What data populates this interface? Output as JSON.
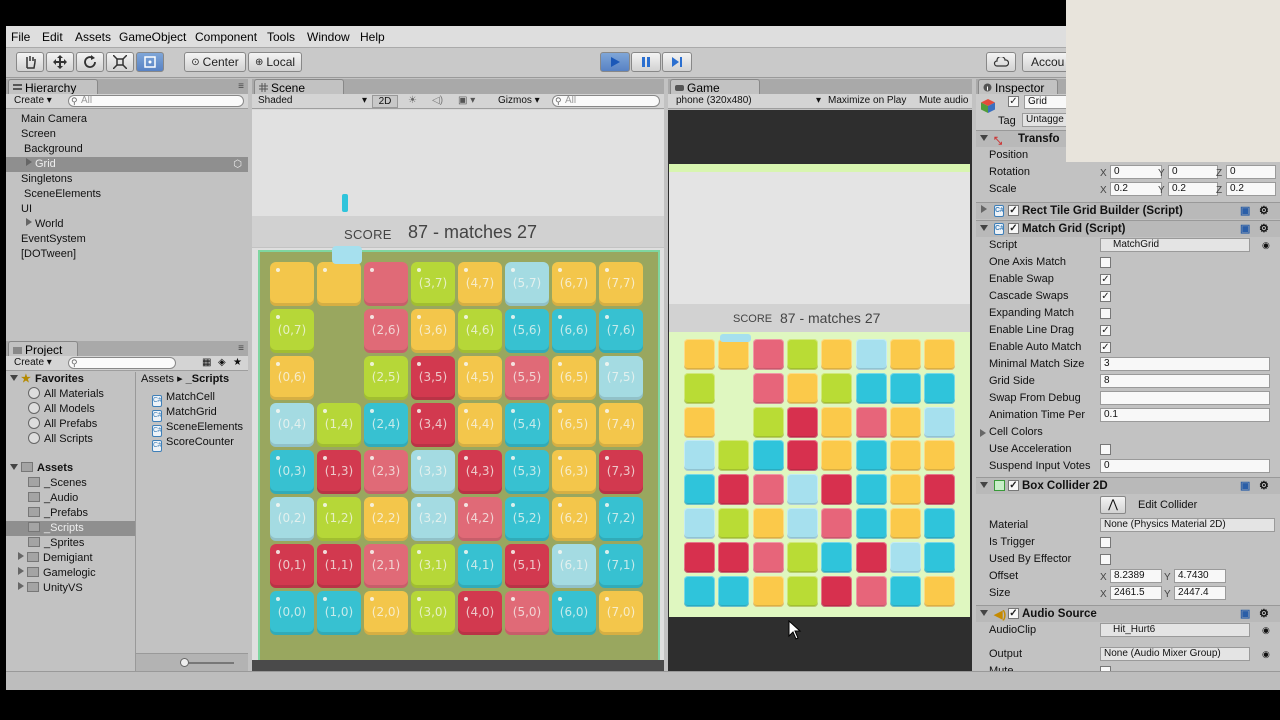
{
  "menu": [
    "File",
    "Edit",
    "Assets",
    "GameObject",
    "Component",
    "Tools",
    "Window",
    "Help"
  ],
  "toolbar": {
    "pivot": "Center",
    "space": "Local",
    "account": "Accou",
    "tool_icons": [
      "hand-icon",
      "move-icon",
      "rotate-icon",
      "scale-icon",
      "rect-icon"
    ]
  },
  "hierarchy": {
    "tab": "Hierarchy",
    "create": "Create",
    "search_placeholder": "All",
    "items": [
      {
        "label": "Main Camera",
        "indent": 0
      },
      {
        "label": "Screen",
        "indent": 0
      },
      {
        "label": "Background",
        "indent": 1
      },
      {
        "label": "Grid",
        "indent": 1,
        "selected": true
      },
      {
        "label": "Singletons",
        "indent": 0
      },
      {
        "label": "SceneElements",
        "indent": 1
      },
      {
        "label": "UI",
        "indent": 0
      },
      {
        "label": "World",
        "indent": 1
      },
      {
        "label": "EventSystem",
        "indent": 0
      },
      {
        "label": "[DOTween]",
        "indent": 0
      }
    ]
  },
  "project": {
    "tab": "Project",
    "create": "Create",
    "favorites_label": "Favorites",
    "favorites": [
      "All Materials",
      "All Models",
      "All Prefabs",
      "All Scripts"
    ],
    "assets_label": "Assets",
    "folders": [
      "_Scenes",
      "_Audio",
      "_Prefabs",
      "_Scripts",
      "_Sprites",
      "Demigiant",
      "Gamelogic",
      "UnityVS"
    ],
    "breadcrumb": [
      "Assets",
      "_Scripts"
    ],
    "files": [
      "MatchCell",
      "MatchGrid",
      "SceneElements",
      "ScoreCounter"
    ]
  },
  "scene": {
    "tab": "Scene",
    "shading": "Shaded",
    "mode2d": "2D",
    "gizmos": "Gizmos",
    "search_placeholder": "All",
    "score_label": "SCORE",
    "score_text": "87 - matches 27",
    "labels_rows": [
      [
        "",
        "",
        "",
        "(3,7)",
        "(4,7)",
        "(5,7)",
        "(6,7)",
        "(7,7)"
      ],
      [
        "(0,7)",
        "",
        "(2,6)",
        "(3,6)",
        "(4,6)",
        "(5,6)",
        "(6,6)",
        "(7,6)"
      ],
      [
        "(0,6)",
        "",
        "(2,5)",
        "(3,5)",
        "(4,5)",
        "(5,5)",
        "(6,5)",
        "(7,5)"
      ],
      [
        "(0,4)",
        "(1,4)",
        "(2,4)",
        "(3,4)",
        "(4,4)",
        "(5,4)",
        "(6,5)",
        "(7,4)"
      ],
      [
        "(0,3)",
        "(1,3)",
        "(2,3)",
        "(3,3)",
        "(4,3)",
        "(5,3)",
        "(6,3)",
        "(7,3)"
      ],
      [
        "(0,2)",
        "(1,2)",
        "(2,2)",
        "(3,2)",
        "(4,2)",
        "(5,2)",
        "(6,2)",
        "(7,2)"
      ],
      [
        "(0,1)",
        "(1,1)",
        "(2,1)",
        "(3,1)",
        "(4,1)",
        "(5,1)",
        "(6,1)",
        "(7,1)"
      ],
      [
        "(0,0)",
        "(1,0)",
        "(2,0)",
        "(3,0)",
        "(4,0)",
        "(5,0)",
        "(6,0)",
        "(7,0)"
      ]
    ]
  },
  "game": {
    "tab": "Game",
    "resolution": "phone (320x480)",
    "maximize": "Maximize on Play",
    "mute": "Mute audio",
    "score_label": "SCORE",
    "score_text": "87 - matches 27"
  },
  "grid_colors": {
    "Y": "#fbc94a",
    "L": "#b9dc35",
    "P": "#e7657a",
    "R": "#d7304e",
    "C": "#2fc4db",
    "B": "#a6e0ee"
  },
  "grid": [
    [
      "Y",
      "Y",
      "P",
      "L",
      "Y",
      "B",
      "Y",
      "Y"
    ],
    [
      "L",
      "",
      "P",
      "Y",
      "L",
      "C",
      "C",
      "C"
    ],
    [
      "Y",
      "",
      "L",
      "R",
      "Y",
      "P",
      "Y",
      "B"
    ],
    [
      "B",
      "L",
      "C",
      "R",
      "Y",
      "C",
      "Y",
      "Y"
    ],
    [
      "C",
      "R",
      "P",
      "B",
      "R",
      "C",
      "Y",
      "R"
    ],
    [
      "B",
      "L",
      "Y",
      "B",
      "P",
      "C",
      "Y",
      "C"
    ],
    [
      "R",
      "R",
      "P",
      "L",
      "C",
      "R",
      "B",
      "C"
    ],
    [
      "C",
      "C",
      "Y",
      "L",
      "R",
      "P",
      "C",
      "Y"
    ]
  ],
  "inspector": {
    "tab": "Inspector",
    "object_name": "Grid",
    "tag_label": "Tag",
    "tag_value": "Untagge",
    "transform": {
      "title": "Transfo",
      "position_label": "Position",
      "rotation_label": "Rotation",
      "scale_label": "Scale",
      "rotation": [
        "0",
        "0",
        "0"
      ],
      "scale": [
        "0.2",
        "0.2",
        "0.2"
      ]
    },
    "rect_builder": "Rect Tile Grid Builder (Script)",
    "match_grid": {
      "title": "Match Grid (Script)",
      "script_label": "Script",
      "script_value": "MatchGrid",
      "rows": [
        {
          "label": "One Axis Match",
          "type": "check",
          "value": false
        },
        {
          "label": "Enable Swap",
          "type": "check",
          "value": true
        },
        {
          "label": "Cascade Swaps",
          "type": "check",
          "value": true
        },
        {
          "label": "Expanding Match",
          "type": "check",
          "value": false
        },
        {
          "label": "Enable Line Drag",
          "type": "check",
          "value": true
        },
        {
          "label": "Enable Auto Match",
          "type": "check",
          "value": true
        },
        {
          "label": "Minimal Match Size",
          "type": "field",
          "value": "3"
        },
        {
          "label": "Grid Side",
          "type": "field",
          "value": "8"
        },
        {
          "label": "Swap From Debug",
          "type": "field",
          "value": ""
        },
        {
          "label": "Animation Time Per",
          "type": "field",
          "value": "0.1"
        },
        {
          "label": "Cell Colors",
          "type": "fold",
          "value": ""
        },
        {
          "label": "Use Acceleration",
          "type": "check",
          "value": false
        },
        {
          "label": "Suspend Input Votes",
          "type": "field",
          "value": "0"
        }
      ]
    },
    "box_collider": {
      "title": "Box Collider 2D",
      "edit": "Edit Collider",
      "material_label": "Material",
      "material_value": "None (Physics Material 2D)",
      "trigger_label": "Is Trigger",
      "effector_label": "Used By Effector",
      "offset_label": "Offset",
      "offset": [
        "8.2389",
        "4.7430"
      ],
      "size_label": "Size",
      "size": [
        "2461.5",
        "2447.4"
      ]
    },
    "audio": {
      "title": "Audio Source",
      "clip_label": "AudioClip",
      "clip_value": "Hit_Hurt6",
      "output_label": "Output",
      "output_value": "None (Audio Mixer Group)",
      "mute_label": "Mute"
    }
  }
}
